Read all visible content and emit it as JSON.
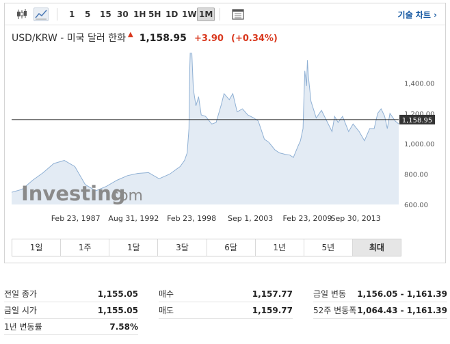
{
  "toolbar": {
    "periods": [
      "1",
      "5",
      "15",
      "30",
      "1H",
      "5H",
      "1D",
      "1W",
      "1M"
    ],
    "active_period": "1M",
    "technical_chart_label": "기술 차트 ›"
  },
  "quote": {
    "name": "USD/KRW - 미국 달러 한화",
    "price": "1,158.95",
    "change": "+3.90",
    "change_pct": "(+0.34%)"
  },
  "chart": {
    "watermark_left": "Investing",
    "watermark_right": ".com",
    "price_tag": "1,158.95",
    "y_ticks": [
      "1,400.00",
      "1,200.00",
      "1,000.00",
      "800.00",
      "600.00"
    ],
    "x_ticks": [
      "Feb 23, 1987",
      "Aug 31, 1992",
      "Feb 23, 1998",
      "Sep 1, 2003",
      "Feb 23, 2009",
      "Sep 30, 2013"
    ]
  },
  "chart_data": {
    "type": "area",
    "ylim": [
      600,
      1600
    ],
    "current_value": 1158.95,
    "x_tick_labels": [
      "Feb 23, 1987",
      "Aug 31, 1992",
      "Feb 23, 1998",
      "Sep 1, 2003",
      "Feb 23, 2009",
      "Sep 30, 2013"
    ],
    "y_tick_labels": [
      "1,400.00",
      "1,200.00",
      "1,000.00",
      "800.00",
      "600.00"
    ],
    "series": [
      {
        "x": [
          "1981-01",
          "1982-01",
          "1983-01",
          "1984-01",
          "1985-01",
          "1986-01",
          "1987-01",
          "1988-01",
          "1989-01",
          "1990-01",
          "1991-01",
          "1992-01",
          "1993-01",
          "1994-01",
          "1995-01",
          "1996-01",
          "1997-01",
          "1997-06",
          "1997-09",
          "1997-11",
          "1997-12",
          "1998-01",
          "1998-02",
          "1998-04",
          "1998-07",
          "1998-10",
          "1999-01",
          "1999-06",
          "2000-01",
          "2000-06",
          "2000-12",
          "2001-03",
          "2001-09",
          "2002-01",
          "2002-06",
          "2002-12",
          "2003-06",
          "2004-01",
          "2004-06",
          "2005-01",
          "2005-06",
          "2006-01",
          "2006-06",
          "2007-01",
          "2007-06",
          "2007-10",
          "2008-03",
          "2008-06",
          "2008-09",
          "2008-10",
          "2008-11",
          "2009-01",
          "2009-02",
          "2009-03",
          "2009-06",
          "2009-12",
          "2010-06",
          "2010-12",
          "2011-06",
          "2011-09",
          "2012-01",
          "2012-06",
          "2013-01",
          "2013-06",
          "2014-01",
          "2014-07",
          "2015-01",
          "2015-06",
          "2015-10",
          "2016-02",
          "2016-06",
          "2016-09",
          "2016-12",
          "2017-06",
          "2017-10"
        ],
        "values": [
          680,
          700,
          760,
          810,
          870,
          890,
          850,
          730,
          690,
          720,
          760,
          790,
          805,
          810,
          770,
          800,
          850,
          890,
          940,
          1100,
          1500,
          1700,
          1640,
          1360,
          1250,
          1310,
          1190,
          1180,
          1130,
          1140,
          1260,
          1330,
          1290,
          1330,
          1210,
          1230,
          1190,
          1170,
          1150,
          1030,
          1010,
          960,
          940,
          930,
          925,
          910,
          980,
          1020,
          1100,
          1300,
          1480,
          1380,
          1550,
          1450,
          1280,
          1170,
          1220,
          1150,
          1080,
          1180,
          1140,
          1180,
          1080,
          1130,
          1080,
          1020,
          1100,
          1100,
          1200,
          1230,
          1180,
          1100,
          1200,
          1150,
          1130
        ]
      }
    ]
  },
  "range_buttons": [
    "1일",
    "1주",
    "1달",
    "3달",
    "6달",
    "1년",
    "5년",
    "최대"
  ],
  "active_range": "최대",
  "stats": {
    "col1": [
      {
        "label": "전일 종가",
        "value": "1,155.05"
      },
      {
        "label": "금일 시가",
        "value": "1,155.05"
      },
      {
        "label": "1년 변동률",
        "value": "7.58%"
      }
    ],
    "col2": [
      {
        "label": "매수",
        "value": "1,157.77"
      },
      {
        "label": "매도",
        "value": "1,159.77"
      }
    ],
    "col3": [
      {
        "label": "금일 변동",
        "value": "1,156.05 - 1,161.39"
      },
      {
        "label": "52주 변동폭",
        "value": "1,064.43 - 1,161.39"
      }
    ]
  }
}
